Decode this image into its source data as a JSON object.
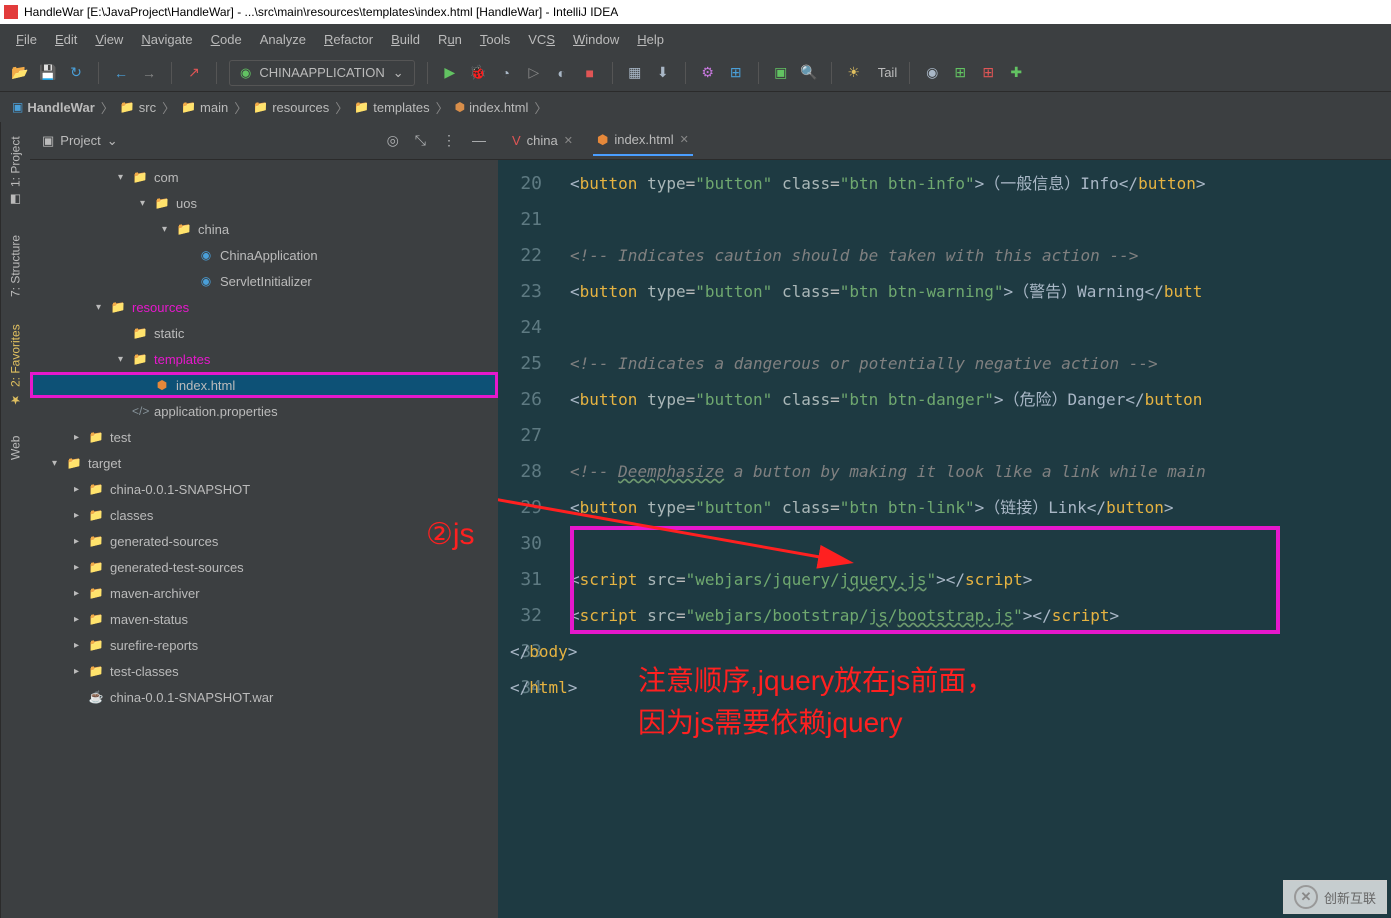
{
  "title_bar": "HandleWar [E:\\JavaProject\\HandleWar] - ...\\src\\main\\resources\\templates\\index.html [HandleWar] - IntelliJ IDEA",
  "menu": {
    "file": "File",
    "edit": "Edit",
    "view": "View",
    "navigate": "Navigate",
    "code": "Code",
    "analyze": "Analyze",
    "refactor": "Refactor",
    "build": "Build",
    "run": "Run",
    "tools": "Tools",
    "vcs": "VCS",
    "window": "Window",
    "help": "Help"
  },
  "toolbar": {
    "run_config": "CHINAAPPLICATION",
    "tail": "Tail"
  },
  "breadcrumb": [
    {
      "icon": "proj",
      "label": "HandleWar"
    },
    {
      "icon": "folder-blue",
      "label": "src"
    },
    {
      "icon": "folder-blue",
      "label": "main"
    },
    {
      "icon": "folder-yel",
      "label": "resources"
    },
    {
      "icon": "folder-yel",
      "label": "templates"
    },
    {
      "icon": "html",
      "label": "index.html"
    }
  ],
  "left_tabs": {
    "project": "1: Project",
    "structure": "7: Structure",
    "favorites": "2: Favorites",
    "web": "Web"
  },
  "project_panel": {
    "title": "Project",
    "tree": [
      {
        "indent": 4,
        "arrow": "v",
        "icon": "folder-yel",
        "label": "com"
      },
      {
        "indent": 5,
        "arrow": "v",
        "icon": "folder-yel",
        "label": "uos"
      },
      {
        "indent": 6,
        "arrow": "v",
        "icon": "folder-yel",
        "label": "china"
      },
      {
        "indent": 7,
        "arrow": "",
        "icon": "class",
        "label": "ChinaApplication"
      },
      {
        "indent": 7,
        "arrow": "",
        "icon": "class",
        "label": "ServletInitializer"
      },
      {
        "indent": 3,
        "arrow": "v",
        "icon": "folder-pink",
        "label": "resources",
        "pink": true
      },
      {
        "indent": 4,
        "arrow": "",
        "icon": "folder-blue",
        "label": "static"
      },
      {
        "indent": 4,
        "arrow": "v",
        "icon": "folder-pink",
        "label": "templates",
        "pink": true
      },
      {
        "indent": 5,
        "arrow": "",
        "icon": "html",
        "label": "index.html",
        "selected": true,
        "highlight": true
      },
      {
        "indent": 4,
        "arrow": "",
        "icon": "props",
        "label": "application.properties"
      },
      {
        "indent": 2,
        "arrow": ">",
        "icon": "folder-green",
        "label": "test"
      },
      {
        "indent": 1,
        "arrow": "v",
        "icon": "folder-red",
        "label": "target"
      },
      {
        "indent": 2,
        "arrow": ">",
        "icon": "folder-red",
        "label": "china-0.0.1-SNAPSHOT"
      },
      {
        "indent": 2,
        "arrow": ">",
        "icon": "folder-red",
        "label": "classes"
      },
      {
        "indent": 2,
        "arrow": ">",
        "icon": "folder-red",
        "label": "generated-sources"
      },
      {
        "indent": 2,
        "arrow": ">",
        "icon": "folder-red",
        "label": "generated-test-sources"
      },
      {
        "indent": 2,
        "arrow": ">",
        "icon": "folder-red",
        "label": "maven-archiver"
      },
      {
        "indent": 2,
        "arrow": ">",
        "icon": "folder-red",
        "label": "maven-status"
      },
      {
        "indent": 2,
        "arrow": ">",
        "icon": "folder-red",
        "label": "surefire-reports"
      },
      {
        "indent": 2,
        "arrow": ">",
        "icon": "folder-red",
        "label": "test-classes"
      },
      {
        "indent": 2,
        "arrow": "",
        "icon": "jar",
        "label": "china-0.0.1-SNAPSHOT.war"
      }
    ]
  },
  "editor_tabs": [
    {
      "icon": "vue",
      "label": "china",
      "active": false,
      "color": "#e05555"
    },
    {
      "icon": "html",
      "label": "index.html",
      "active": true,
      "color": "#e6883a"
    }
  ],
  "code_lines": [
    {
      "n": 20,
      "html": "<span class='c-text'>&lt;</span><span class='c-tag'>button</span> <span class='c-attr'>type</span>=<span class='c-str'>\"button\"</span> <span class='c-attr'>class</span>=<span class='c-str'>\"btn btn-info\"</span><span class='c-text'>&gt;（一般信息）Info&lt;/</span><span class='c-tag'>button</span><span class='c-text'>&gt;</span>"
    },
    {
      "n": 21,
      "html": ""
    },
    {
      "n": 22,
      "html": "<span class='c-comment'>&lt;!-- Indicates caution should be taken with this action --&gt;</span>"
    },
    {
      "n": 23,
      "html": "<span class='c-text'>&lt;</span><span class='c-tag'>button</span> <span class='c-attr'>type</span>=<span class='c-str'>\"button\"</span> <span class='c-attr'>class</span>=<span class='c-str'>\"btn btn-warning\"</span><span class='c-text'>&gt;（警告）Warning&lt;/</span><span class='c-tag'>butt</span>"
    },
    {
      "n": 24,
      "html": ""
    },
    {
      "n": 25,
      "html": "<span class='c-comment'>&lt;!-- Indicates a dangerous or potentially negative action --&gt;</span>"
    },
    {
      "n": 26,
      "html": "<span class='c-text'>&lt;</span><span class='c-tag'>button</span> <span class='c-attr'>type</span>=<span class='c-str'>\"button\"</span> <span class='c-attr'>class</span>=<span class='c-str'>\"btn btn-danger\"</span><span class='c-text'>&gt;（危险）Danger&lt;/</span><span class='c-tag'>button</span>"
    },
    {
      "n": 27,
      "html": ""
    },
    {
      "n": 28,
      "html": "<span class='c-comment'>&lt;!-- <span class='c-underline'>Deemphasize</span> a button by making it look like a link while main</span>"
    },
    {
      "n": 29,
      "html": "<span class='c-text'>&lt;</span><span class='c-tag'>button</span> <span class='c-attr'>type</span>=<span class='c-str'>\"button\"</span> <span class='c-attr'>class</span>=<span class='c-str'>\"btn btn-link\"</span><span class='c-text'>&gt;（链接）Link&lt;/</span><span class='c-tag'>button</span><span class='c-text'>&gt;</span>"
    },
    {
      "n": 30,
      "html": ""
    },
    {
      "n": 31,
      "html": "<span class='c-text'>&lt;</span><span class='c-tag'>script</span> <span class='c-attr'>src</span>=<span class='c-str'>\"webjars/jquery/<span class='c-underline'>jquery.js</span>\"</span><span class='c-text'>&gt;&lt;/</span><span class='c-tag'>script</span><span class='c-text'>&gt;</span>"
    },
    {
      "n": 32,
      "html": "<span class='c-text'>&lt;</span><span class='c-tag'>script</span> <span class='c-attr'>src</span>=<span class='c-str'>\"webjars/bootstrap/<span class='c-underline'>js</span>/<span class='c-underline'>bootstrap.js</span>\"</span><span class='c-text'>&gt;&lt;/</span><span class='c-tag'>script</span><span class='c-text'>&gt;</span>"
    },
    {
      "n": 33,
      "html": "<span class='c-text' style='margin-left:-60px'>&lt;/</span><span class='c-tag'>body</span><span class='c-text'>&gt;</span>"
    },
    {
      "n": 34,
      "html": "<span class='c-text' style='margin-left:-60px'>&lt;/</span><span class='c-tag'>html</span><span class='c-text'>&gt;</span>"
    }
  ],
  "annotations": {
    "js_label": "②js",
    "note_line1": "注意顺序,jquery放在js前面，",
    "note_line2": "因为js需要依赖jquery"
  },
  "watermark": "创新互联"
}
